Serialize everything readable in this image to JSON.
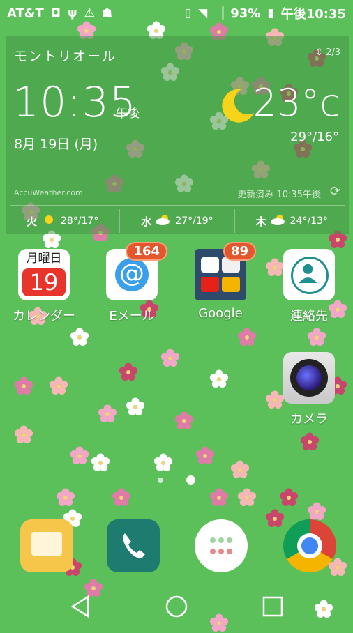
{
  "status_bar": {
    "carrier": "AT&T",
    "left_icons": [
      "voicemail-icon",
      "usb-icon",
      "warning-icon",
      "android-debug-icon"
    ],
    "right_icons": [
      "vibrate-icon",
      "wifi-icon",
      "signal-icon",
      "battery-icon"
    ],
    "battery": "93%",
    "time": "午後10:35"
  },
  "weather_widget": {
    "city": "モントリオール",
    "page_indicator": "2/3",
    "time": "10:35",
    "ampm": "午後",
    "date": "8月 19日 (月)",
    "temperature": "23°c",
    "high_low": "29°/16°",
    "brand": "AccuWeather.com",
    "updated": "更新済み 10:35午後",
    "forecast": [
      {
        "day": "火",
        "icon": "sunny-icon",
        "temps": "28°/17°"
      },
      {
        "day": "水",
        "icon": "partly-cloudy-icon",
        "temps": "27°/19°"
      },
      {
        "day": "木",
        "icon": "partly-cloudy-icon",
        "temps": "24°/13°"
      }
    ]
  },
  "apps": {
    "calendar": {
      "label": "カレンダー",
      "header": "月曜日",
      "day": "19"
    },
    "email": {
      "label": "Eメール",
      "badge": "164"
    },
    "google": {
      "label": "Google",
      "badge": "89"
    },
    "contacts": {
      "label": "連絡先"
    },
    "camera": {
      "label": "カメラ"
    }
  },
  "dock": [
    "messages-icon",
    "phone-icon",
    "app-drawer-icon",
    "chrome-icon"
  ],
  "nav": [
    "back-button",
    "home-button",
    "recents-button"
  ],
  "colors": {
    "wallpaper": "#5cc05a",
    "badge": "#e4572e",
    "calendar_red": "#e8352b"
  }
}
